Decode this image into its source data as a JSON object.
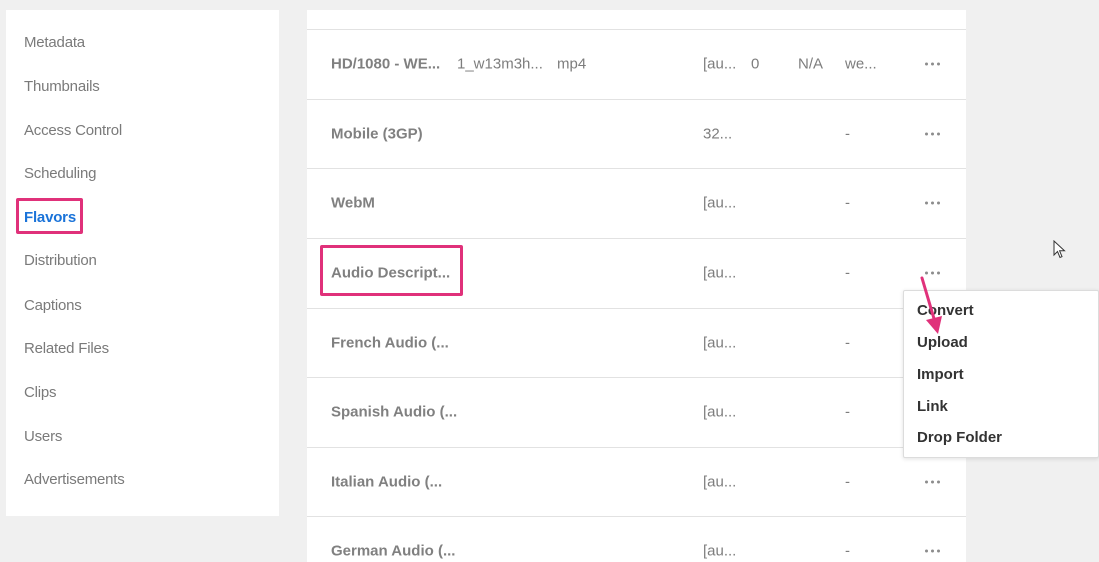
{
  "sidebar": {
    "items": [
      {
        "label": "Metadata",
        "active": false
      },
      {
        "label": "Thumbnails",
        "active": false
      },
      {
        "label": "Access Control",
        "active": false
      },
      {
        "label": "Scheduling",
        "active": false
      },
      {
        "label": "Flavors",
        "active": true
      },
      {
        "label": "Distribution",
        "active": false
      },
      {
        "label": "Captions",
        "active": false
      },
      {
        "label": "Related Files",
        "active": false
      },
      {
        "label": "Clips",
        "active": false
      },
      {
        "label": "Users",
        "active": false
      },
      {
        "label": "Advertisements",
        "active": false
      }
    ]
  },
  "flavors": {
    "rows": [
      {
        "name": "HD/1080 - WE...",
        "id": "1_w13m3h...",
        "format": "mp4",
        "codec": "[au...",
        "bitrate": "0",
        "size": "N/A",
        "tags": "we..."
      },
      {
        "name": "Mobile (3GP)",
        "codec": "32...",
        "size": "-"
      },
      {
        "name": "WebM",
        "codec": "[au...",
        "size": "-"
      },
      {
        "name": "Audio Descript...",
        "codec": "[au...",
        "size": "-"
      },
      {
        "name": "French Audio (...",
        "codec": "[au...",
        "size": "-"
      },
      {
        "name": "Spanish Audio (...",
        "codec": "[au...",
        "size": "-"
      },
      {
        "name": "Italian Audio (...",
        "codec": "[au...",
        "size": "-"
      },
      {
        "name": "German Audio (...",
        "codec": "[au...",
        "size": "-"
      }
    ]
  },
  "actions_menu": {
    "items": [
      "Convert",
      "Upload",
      "Import",
      "Link",
      "Drop Folder"
    ]
  },
  "colors": {
    "highlight": "#e0317a",
    "active_link": "#1a73d9",
    "muted_text": "#7a7a7a"
  },
  "icons": [
    "more-actions-icon",
    "mouse-cursor-icon",
    "annotation-arrow-icon"
  ]
}
